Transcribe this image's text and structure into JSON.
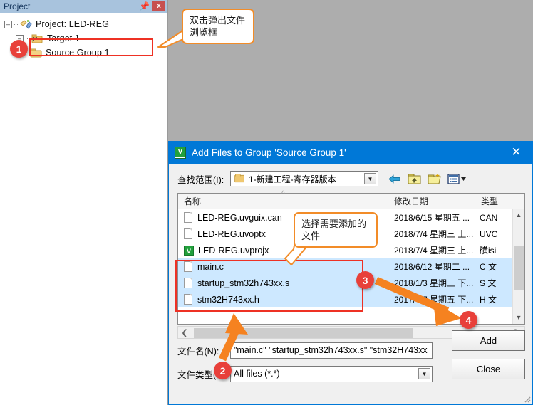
{
  "project_panel": {
    "title": "Project",
    "pin_icon": "pin-icon",
    "close_label": "x",
    "tree": [
      {
        "label": "Project: LED-REG",
        "level": 0,
        "icon": "project-icon",
        "expander": "-"
      },
      {
        "label": "Target 1",
        "level": 1,
        "icon": "target-folder-icon",
        "expander": "-"
      },
      {
        "label": "Source Group 1",
        "level": 2,
        "icon": "folder-icon",
        "expander": ""
      }
    ]
  },
  "annotations": {
    "callout_1": "双击弹出文件\n浏览框",
    "callout_1_line1": "双击弹出文件",
    "callout_1_line2": "浏览框",
    "callout_2_line1": "选择需要添加的",
    "callout_2_line2": "文件",
    "badges": [
      "1",
      "2",
      "3",
      "4"
    ],
    "highlight_color": "#ee3124",
    "callout_color": "#f28c28",
    "badge_color": "#e8403a"
  },
  "dialog": {
    "title": "Add Files to Group 'Source Group 1'",
    "app_icon": "uvision-icon",
    "close_icon": "close-icon",
    "look_in": {
      "label": "查找范围(I):",
      "value": "1-新建工程-寄存器版本",
      "folder_icon": "folder-icon",
      "dropdown_icon": "chevron-down-icon"
    },
    "nav_icons": [
      {
        "name": "back-arrow-icon"
      },
      {
        "name": "up-folder-icon"
      },
      {
        "name": "new-folder-icon"
      },
      {
        "name": "view-mode-icon"
      }
    ],
    "list": {
      "columns": [
        "名称",
        "修改日期",
        "类型"
      ],
      "sort_indicator": "^",
      "rows": [
        {
          "name": "LED-REG.uvguix.can",
          "date": "2018/6/15 星期五 ...",
          "type": "CAN",
          "icon": "file-icon",
          "selected": false
        },
        {
          "name": "LED-REG.uvoptx",
          "date": "2018/7/4 星期三 上...",
          "type": "UVC",
          "icon": "file-icon",
          "selected": false
        },
        {
          "name": "LED-REG.uvprojx",
          "date": "2018/7/4 星期三 上...",
          "type": "磺isi",
          "icon": "uvision-file-icon",
          "selected": false
        },
        {
          "name": "main.c",
          "date": "2018/6/12 星期二 ...",
          "type": "C 文",
          "icon": "file-icon",
          "selected": true
        },
        {
          "name": "startup_stm32h743xx.s",
          "date": "2018/1/3 星期三 下...",
          "type": "S 文",
          "icon": "file-icon",
          "selected": true
        },
        {
          "name": "stm32H743xx.h",
          "date": "2017/4/7 星期五 下...",
          "type": "H 文",
          "icon": "file-icon",
          "selected": true
        }
      ]
    },
    "scroll": {
      "v_up_icon": "chevron-up-icon",
      "v_down_icon": "chevron-down-icon",
      "h_left_icon": "chevron-left-icon",
      "h_right_icon": "chevron-right-icon"
    },
    "file_name": {
      "label": "文件名(N):",
      "value": "\"main.c\" \"startup_stm32h743xx.s\" \"stm32H743xx"
    },
    "file_type": {
      "label": "文件类型(T):",
      "value": "All files (*.*)",
      "dropdown_icon": "chevron-down-icon"
    },
    "buttons": {
      "add": "Add",
      "close": "Close"
    }
  }
}
